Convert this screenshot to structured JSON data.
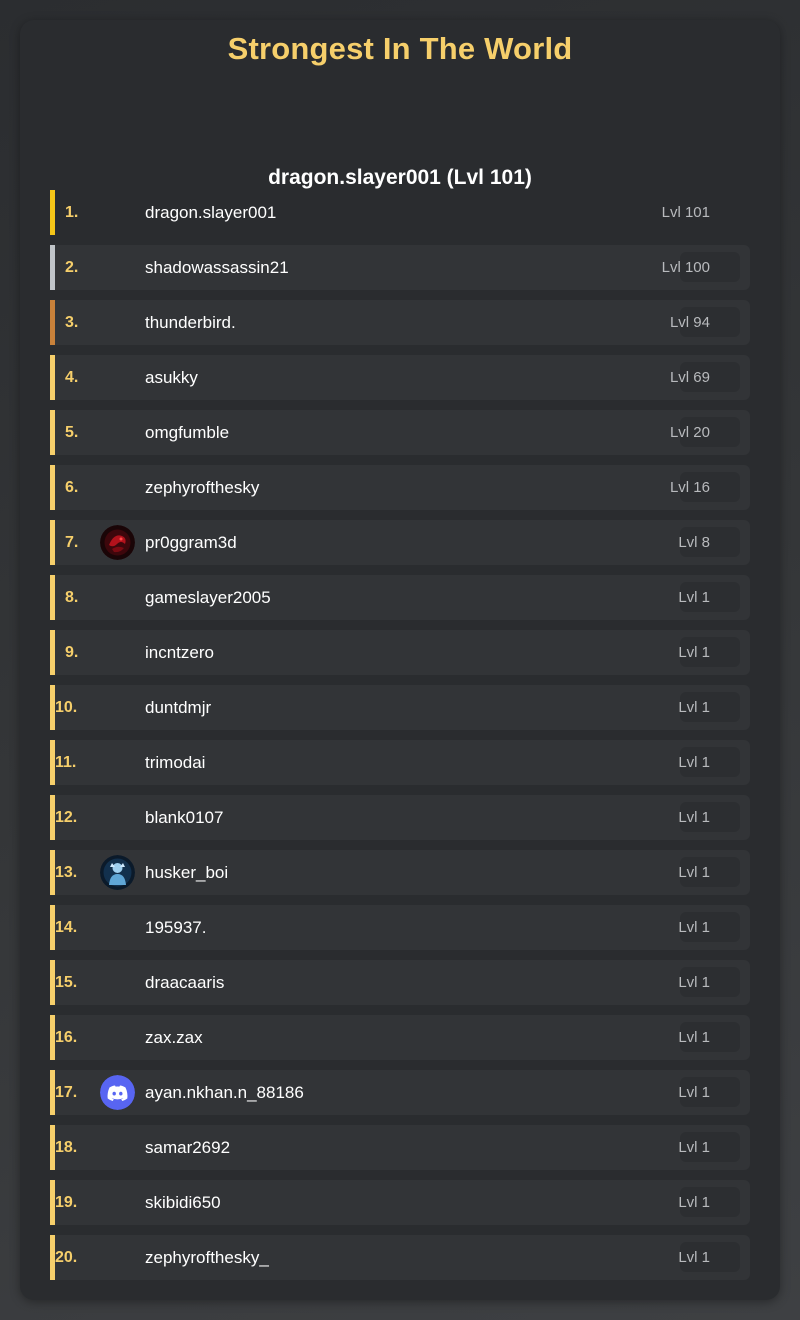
{
  "header": {
    "title": "Strongest In The World",
    "top_user": "dragon.slayer001 (Lvl 101)"
  },
  "colors": {
    "accent": "#f6cf6b",
    "gold": "#f5c518",
    "silver": "#c0c4c8",
    "bronze": "#c8813a",
    "discord": "#5865f2"
  },
  "leaderboard": [
    {
      "rank": "1.",
      "name": "dragon.slayer001",
      "level": "Lvl 101",
      "avatar": "none"
    },
    {
      "rank": "2.",
      "name": "shadowassassin21",
      "level": "Lvl 100",
      "avatar": "none"
    },
    {
      "rank": "3.",
      "name": "thunderbird.",
      "level": "Lvl 94",
      "avatar": "none"
    },
    {
      "rank": "4.",
      "name": "asukky",
      "level": "Lvl 69",
      "avatar": "none"
    },
    {
      "rank": "5.",
      "name": "omgfumble",
      "level": "Lvl 20",
      "avatar": "none"
    },
    {
      "rank": "6.",
      "name": "zephyrofthesky",
      "level": "Lvl 16",
      "avatar": "none"
    },
    {
      "rank": "7.",
      "name": "pr0ggram3d",
      "level": "Lvl 8",
      "avatar": "red-dragon-avatar"
    },
    {
      "rank": "8.",
      "name": "gameslayer2005",
      "level": "Lvl 1",
      "avatar": "none"
    },
    {
      "rank": "9.",
      "name": "incntzero",
      "level": "Lvl 1",
      "avatar": "none"
    },
    {
      "rank": "10.",
      "name": "duntdmjr",
      "level": "Lvl 1",
      "avatar": "none"
    },
    {
      "rank": "11.",
      "name": "trimodai",
      "level": "Lvl 1",
      "avatar": "none"
    },
    {
      "rank": "12.",
      "name": "blank0107",
      "level": "Lvl 1",
      "avatar": "none"
    },
    {
      "rank": "13.",
      "name": "husker_boi",
      "level": "Lvl 1",
      "avatar": "blue-figure-avatar"
    },
    {
      "rank": "14.",
      "name": "195937.",
      "level": "Lvl 1",
      "avatar": "none"
    },
    {
      "rank": "15.",
      "name": "draacaaris",
      "level": "Lvl 1",
      "avatar": "none"
    },
    {
      "rank": "16.",
      "name": "zax.zax",
      "level": "Lvl 1",
      "avatar": "none"
    },
    {
      "rank": "17.",
      "name": "ayan.nkhan.n_88186",
      "level": "Lvl 1",
      "avatar": "discord-default-avatar"
    },
    {
      "rank": "18.",
      "name": "samar2692",
      "level": "Lvl 1",
      "avatar": "none"
    },
    {
      "rank": "19.",
      "name": "skibidi650",
      "level": "Lvl 1",
      "avatar": "none"
    },
    {
      "rank": "20.",
      "name": "zephyrofthesky_",
      "level": "Lvl 1",
      "avatar": "none"
    }
  ]
}
